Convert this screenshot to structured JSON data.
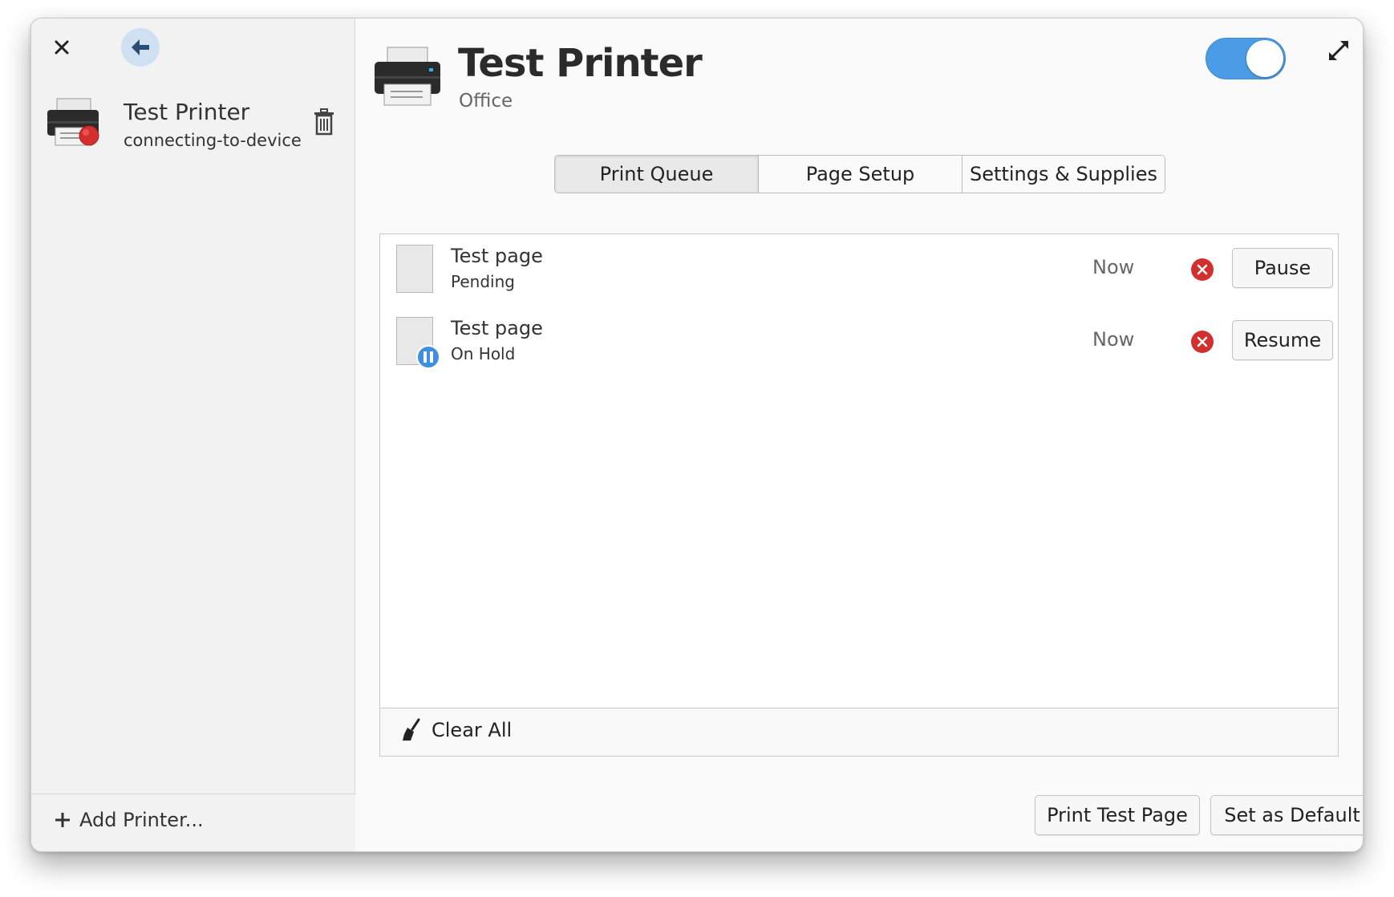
{
  "window": {
    "sidebar": {
      "printers": [
        {
          "name": "Test Printer",
          "status": "connecting-to-device",
          "status_color": "#d32f2f"
        }
      ],
      "add_printer_label": "Add Printer..."
    },
    "header": {
      "title": "Test Printer",
      "location": "Office",
      "enabled": true,
      "accent": "#4b9ce6"
    },
    "tabs": [
      {
        "label": "Print Queue",
        "active": true
      },
      {
        "label": "Page Setup",
        "active": false
      },
      {
        "label": "Settings & Supplies",
        "active": false
      }
    ],
    "jobs": [
      {
        "name": "Test page",
        "state": "Pending",
        "time": "Now",
        "action": "Pause",
        "on_hold": false
      },
      {
        "name": "Test page",
        "state": "On Hold",
        "time": "Now",
        "action": "Resume",
        "on_hold": true
      }
    ],
    "clear_all_label": "Clear All",
    "print_test_page_label": "Print Test Page",
    "set_default_label": "Set as Default",
    "icons": [
      "close-icon",
      "back-arrow-icon",
      "printer-icon",
      "trash-icon",
      "plus-icon",
      "expand-icon",
      "cancel-icon",
      "pause-badge-icon",
      "broom-icon"
    ]
  }
}
